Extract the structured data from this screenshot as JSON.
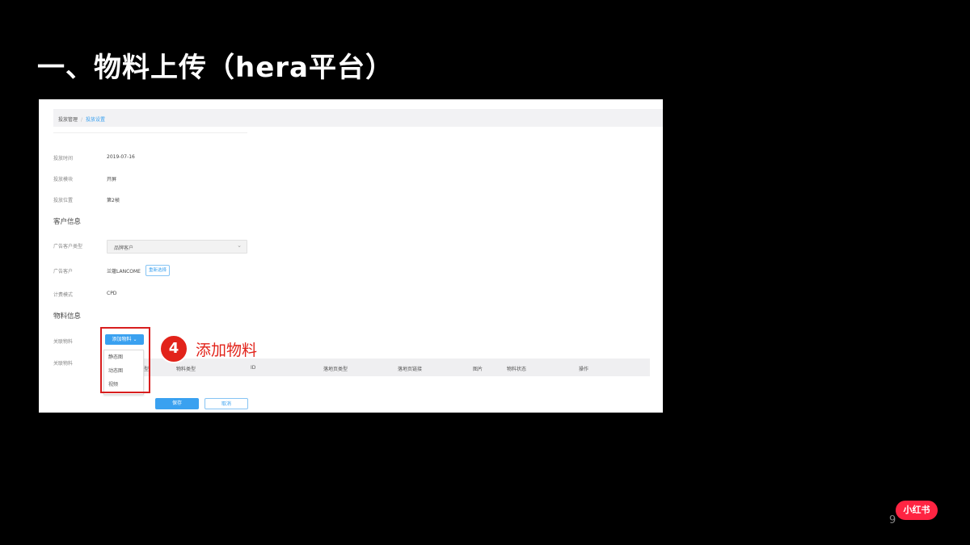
{
  "slide": {
    "title": "一、物料上传（hera平台）",
    "page_number": "9",
    "logo_text": "小红书"
  },
  "breadcrumb": {
    "parent": "投放管理",
    "separator": "/",
    "current": "投放设置"
  },
  "fields": [
    {
      "label": "投放时间",
      "value": "2019-07-16"
    },
    {
      "label": "投放模块",
      "value": "开屏"
    },
    {
      "label": "投放位置",
      "value": "第2帧"
    }
  ],
  "customer_section": {
    "title": "客户信息",
    "type_label": "广告客户类型",
    "type_value": "品牌客户",
    "customer_label": "广告客户",
    "customer_value": "兰蔻LANCOME",
    "reselect_button": "重新选择",
    "mode_label": "计费模式",
    "mode_value": "CPD"
  },
  "material_section": {
    "title": "物料信息",
    "add_label": "关联物料",
    "add_button": "添加物料",
    "list_label": "关联物料",
    "menu_items": [
      "静态图",
      "动态图",
      "视频"
    ],
    "columns": [
      "物料类型",
      "ID",
      "落地页类型",
      "落地页链接",
      "图片",
      "物料状态",
      "操作"
    ],
    "hidden_column_fragment": "型"
  },
  "footer": {
    "save_button": "保存",
    "cancel_button": "取消"
  },
  "annotation": {
    "step_number": "4",
    "step_text": "添加物料",
    "color": "#e2231a"
  }
}
